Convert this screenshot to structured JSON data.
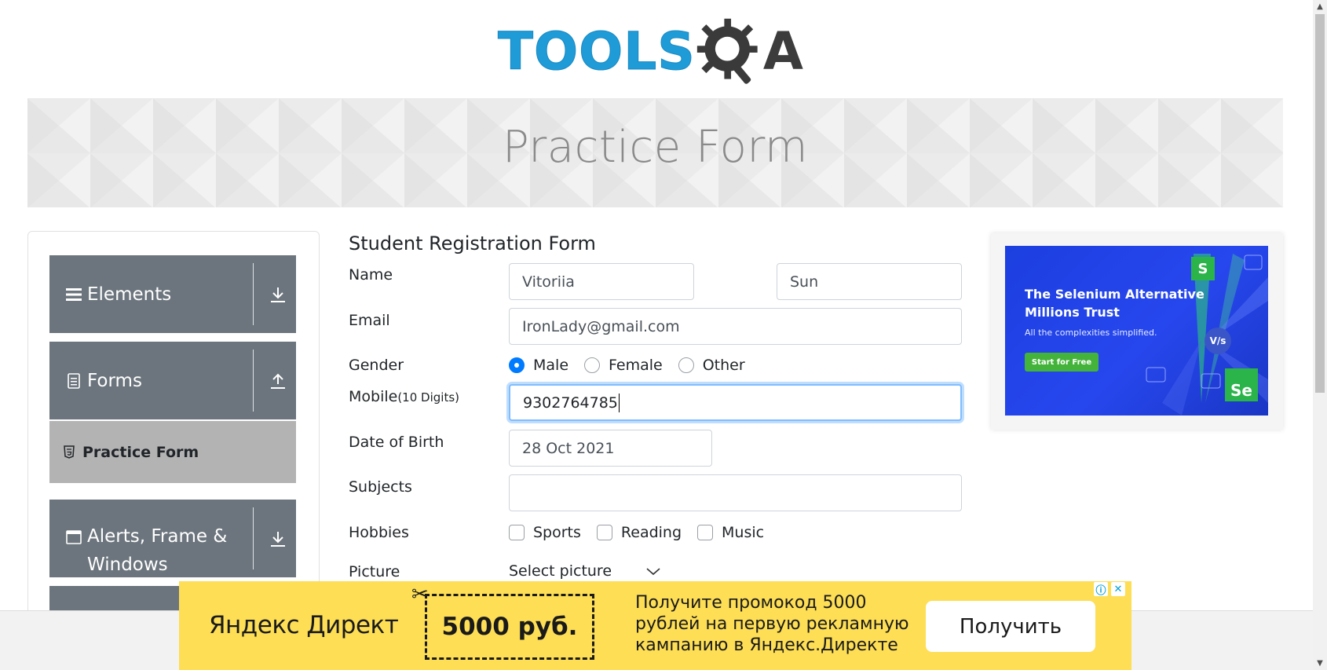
{
  "logo": {
    "text_tools": "TOOLS",
    "text_a": "A",
    "brand_colors": {
      "blue": "#1f9bd7",
      "dark": "#3c3c3c"
    }
  },
  "banner": {
    "title": "Practice Form"
  },
  "sidebar": {
    "groups": [
      {
        "label": "Elements",
        "icon": "hamburger-menu-icon",
        "arrow": "download-arrow-icon"
      },
      {
        "label": "Forms",
        "icon": "document-icon",
        "arrow": "upload-arrow-icon"
      },
      {
        "label": "Alerts, Frame &",
        "label2": "Windows",
        "icon": "window-icon",
        "arrow": "download-arrow-icon"
      }
    ],
    "active_item": {
      "label": "Practice Form",
      "icon": "html5-icon"
    },
    "header_color": "#6c757d",
    "active_color": "#b3b3b3"
  },
  "form": {
    "title": "Student Registration Form",
    "name_label": "Name",
    "first_name": "Vitoriia",
    "last_name": "Sun",
    "email_label": "Email",
    "email": "IronLady@gmail.com",
    "gender_label": "Gender",
    "gender_options": [
      "Male",
      "Female",
      "Other"
    ],
    "gender_selected": "Male",
    "mobile_label": "Mobile",
    "mobile_hint": "(10 Digits)",
    "mobile": "9302764785",
    "dob_label": "Date of Birth",
    "dob": "28 Oct 2021",
    "subjects_label": "Subjects",
    "subjects": "",
    "hobbies_label": "Hobbies",
    "hobbies_options": [
      "Sports",
      "Reading",
      "Music"
    ],
    "picture_label": "Picture",
    "picture_select": "Select picture"
  },
  "ad_right": {
    "headline": "The Selenium Alternative Millions Trust",
    "sub": "All the complexities simplified.",
    "cta": "Start for Free",
    "badge_s": "S",
    "badge_vs": "V/s",
    "badge_se": "Se"
  },
  "ad_bottom": {
    "brand": "Яндекс Директ",
    "coupon": "5000 руб.",
    "text": "Получите промокод 5000 рублей на первую рекламную кампанию в Яндекс.Директе",
    "cta": "Получить",
    "scissors_icon": "✂",
    "info_icon": "ⓘ",
    "close_icon": "✕",
    "bg_color": "#fdde55"
  },
  "scrollbar": {
    "up": "▲",
    "down": "▼"
  }
}
